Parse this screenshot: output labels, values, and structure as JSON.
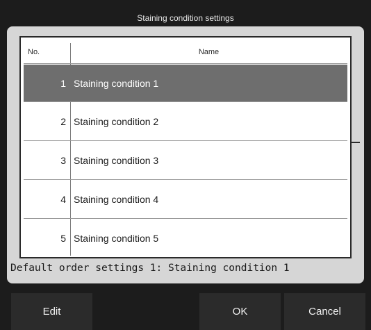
{
  "dialog": {
    "title": "Staining condition settings"
  },
  "table": {
    "headers": {
      "no": "No.",
      "name": "Name"
    },
    "rows": [
      {
        "no": "1",
        "name": "Staining condition 1",
        "selected": true
      },
      {
        "no": "2",
        "name": "Staining condition 2"
      },
      {
        "no": "3",
        "name": "Staining condition 3"
      },
      {
        "no": "4",
        "name": "Staining condition 4"
      },
      {
        "no": "5",
        "name": "Staining condition 5"
      }
    ]
  },
  "default_order": "Default order settings 1: Staining condition 1",
  "buttons": {
    "edit": "Edit",
    "ok": "OK",
    "cancel": "Cancel"
  },
  "colors": {
    "selected_row": "#6e6e6e",
    "dialog_bg": "#1c1c1c",
    "panel_bg": "#d6d6d6"
  }
}
